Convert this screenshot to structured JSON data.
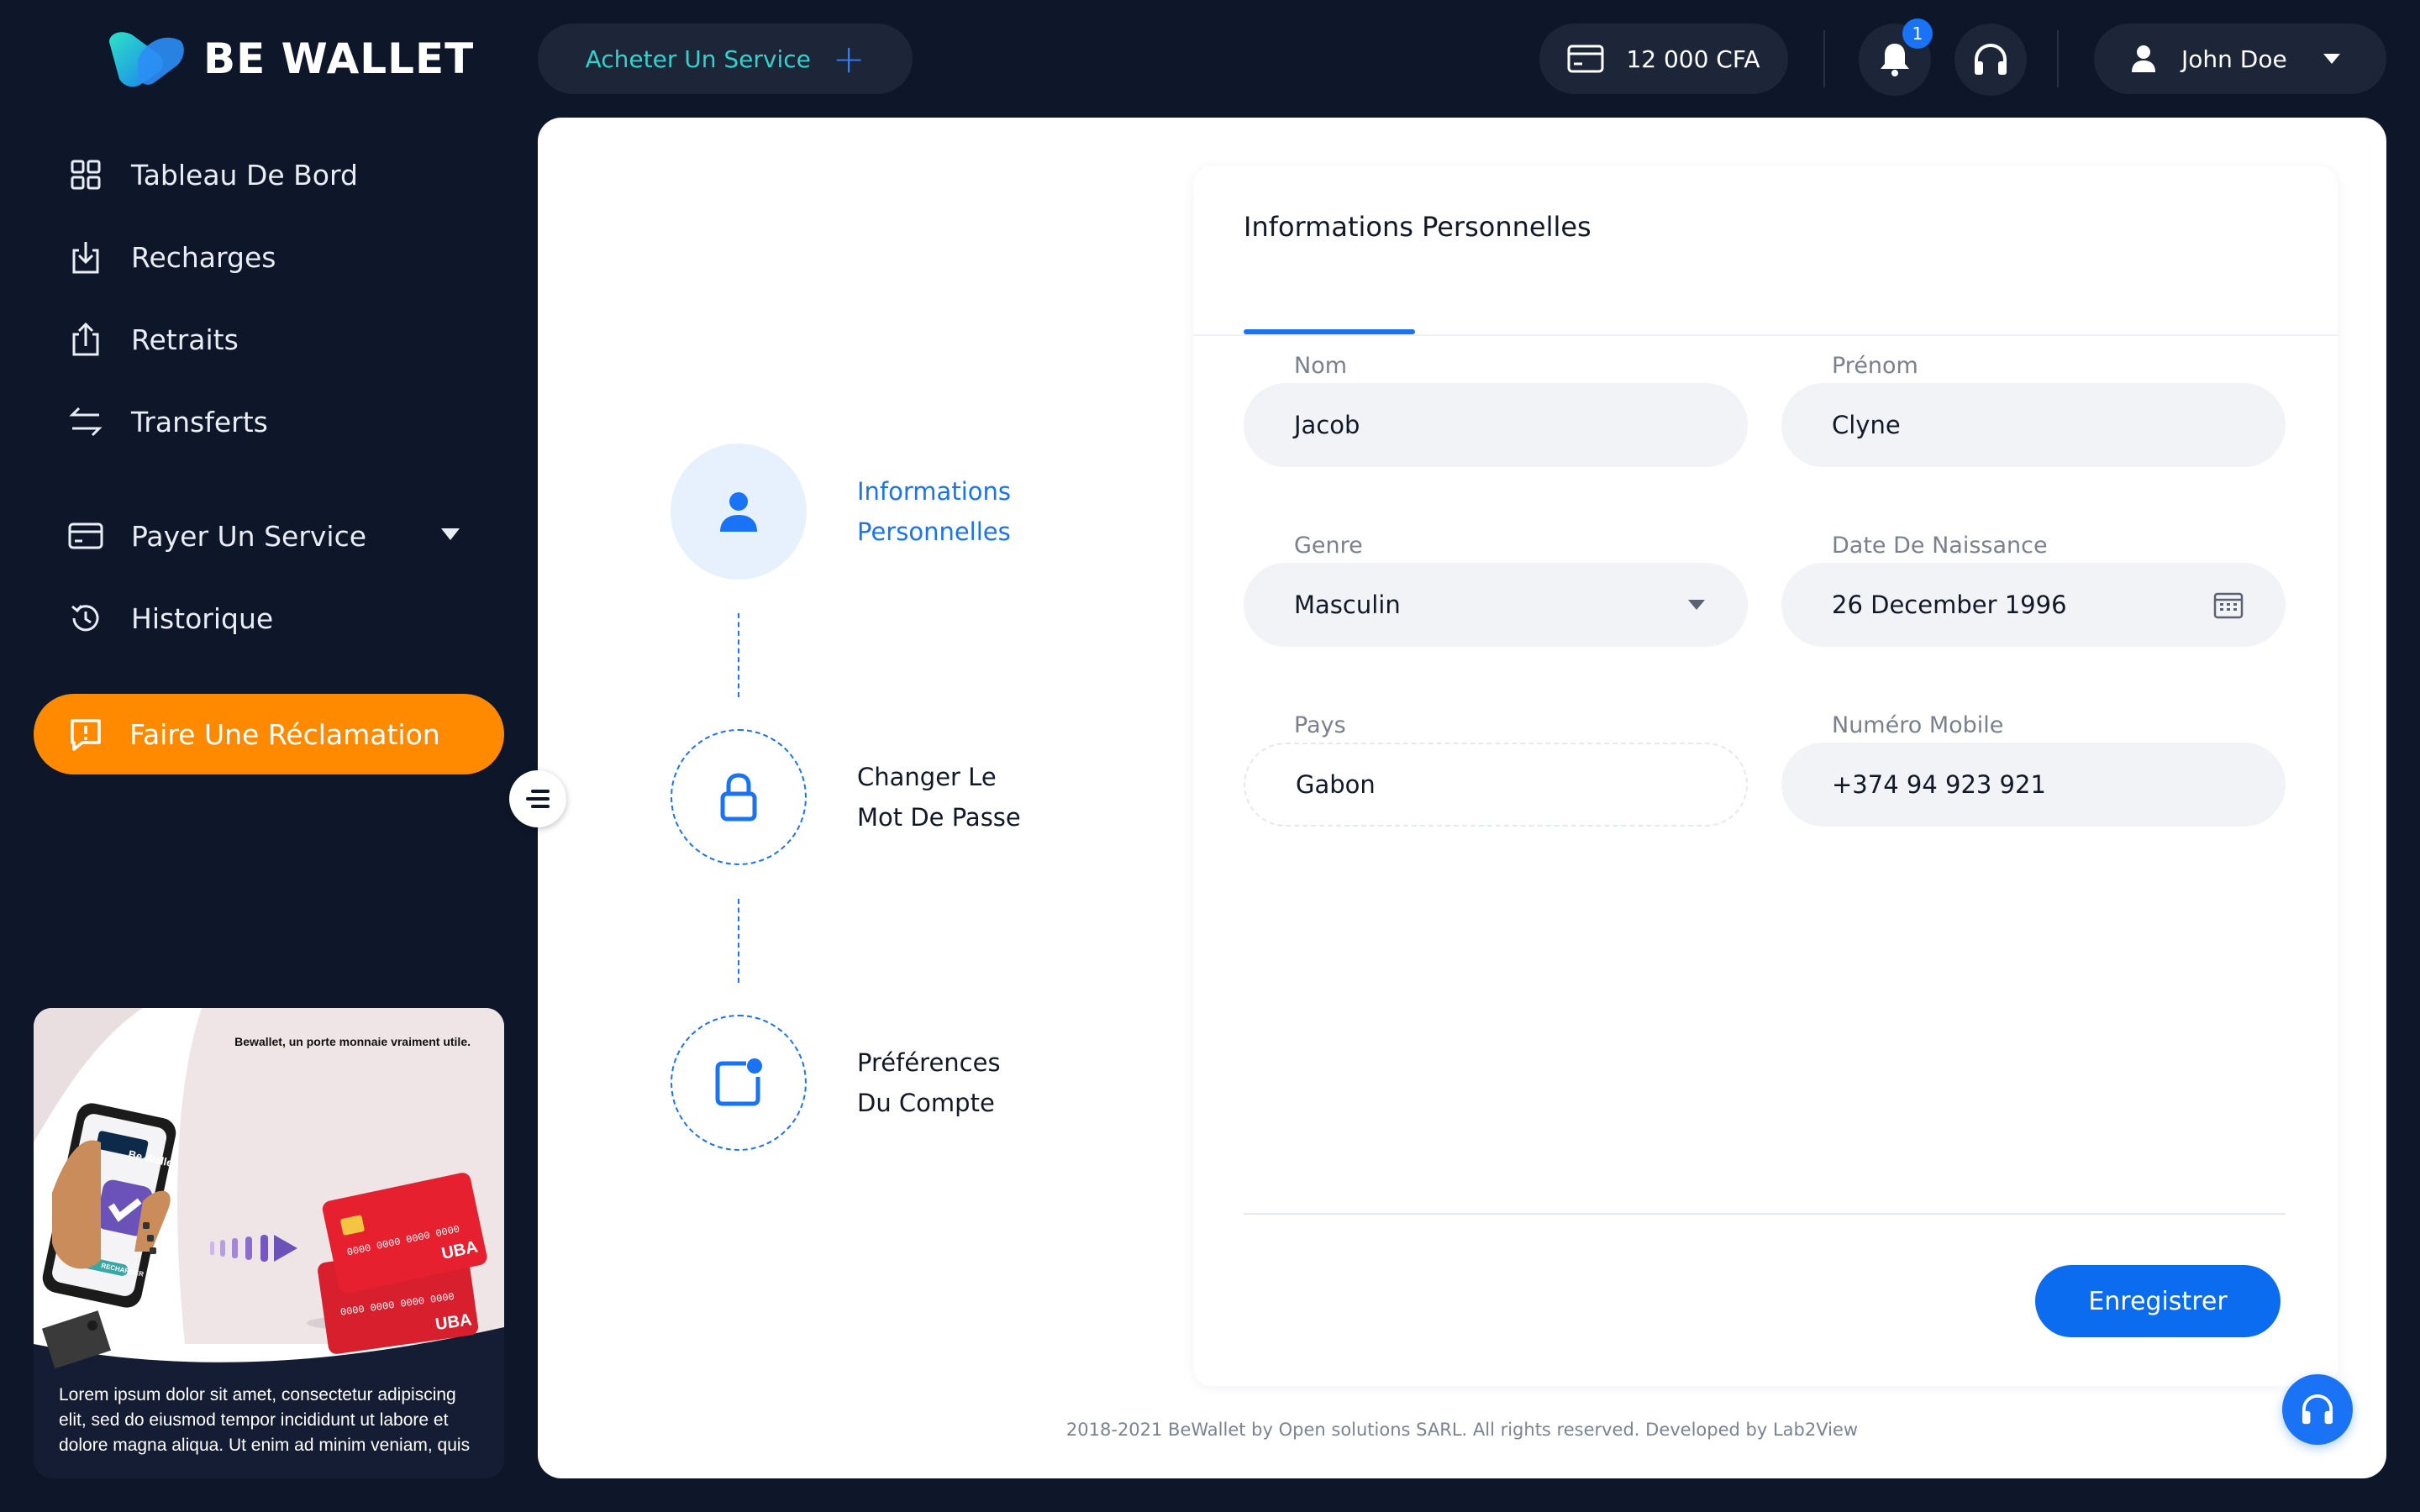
{
  "brand": {
    "name": "BE WALLET"
  },
  "header": {
    "buy_service_label": "Acheter Un Service",
    "balance": "12 000 CFA",
    "notifications_count": "1",
    "user_name": "John Doe"
  },
  "sidebar": {
    "items": [
      {
        "label": "Tableau De Bord",
        "icon": "grid-icon"
      },
      {
        "label": "Recharges",
        "icon": "download-icon"
      },
      {
        "label": "Retraits",
        "icon": "upload-icon"
      },
      {
        "label": "Transferts",
        "icon": "transfer-arrows-icon"
      },
      {
        "label": "Payer Un Service",
        "icon": "card-icon",
        "has_dropdown": true
      },
      {
        "label": "Historique",
        "icon": "history-icon"
      }
    ],
    "claim_label": "Faire Une Réclamation",
    "promo": {
      "headline": "Bewallet, un porte monnaie vraiment utile.",
      "phone_brand": "Be Wallet",
      "phone_button": "RECHARGER",
      "card_number": "0000 0000 0000 0000",
      "card_bank": "UBA",
      "text": "Lorem ipsum dolor sit amet, consectetur adipiscing elit, sed do eiusmod tempor incididunt ut labore et dolore magna aliqua. Ut enim ad minim veniam, quis"
    }
  },
  "steps": [
    {
      "line1": "Informations",
      "line2": "Personnelles",
      "active": true,
      "icon": "user-icon"
    },
    {
      "line1": "Changer Le",
      "line2": "Mot De Passe",
      "active": false,
      "icon": "lock-icon"
    },
    {
      "line1": "Préférences",
      "line2": "Du Compte",
      "active": false,
      "icon": "preferences-icon"
    }
  ],
  "form": {
    "title": "Informations Personnelles",
    "fields": {
      "nom": {
        "label": "Nom",
        "value": "Jacob"
      },
      "prenom": {
        "label": "Prénom",
        "value": "Clyne"
      },
      "genre": {
        "label": "Genre",
        "value": "Masculin"
      },
      "naissance": {
        "label": "Date De Naissance",
        "value": "26 December 1996"
      },
      "pays": {
        "label": "Pays",
        "value": "Gabon"
      },
      "mobile": {
        "label": "Numéro Mobile",
        "value": "+374 94 923 921"
      }
    },
    "save_label": "Enregistrer"
  },
  "footer": {
    "text": "2018-2021 BeWallet by Open solutions SARL. All rights reserved. Developed by Lab2View"
  },
  "colors": {
    "background": "#0e1629",
    "accent": "#1a73f5",
    "orange": "#ff8a00",
    "teal": "#33d1cc",
    "panel": "#ffffff"
  }
}
